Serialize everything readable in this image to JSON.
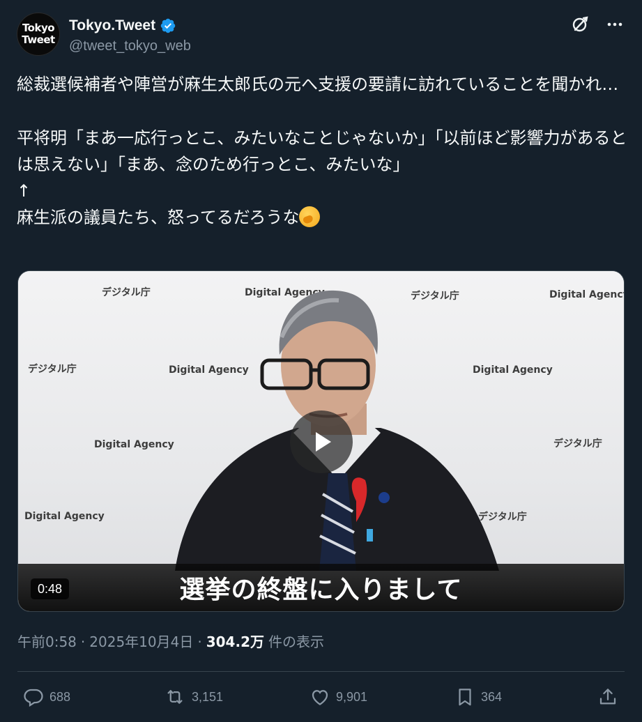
{
  "author": {
    "display_name": "Tokyo.Tweet",
    "handle": "@tweet_tokyo_web",
    "avatar_line1": "Tokyo",
    "avatar_line2": "Tweet",
    "verified": true
  },
  "header_actions": {
    "grok_icon": "grok-icon",
    "more_icon": "more-icon"
  },
  "tweet": {
    "paragraph1": "総裁選候補者や陣営が麻生太郎氏の元へ支援の要請に訪れていることを聞かれ…",
    "paragraph2": "平将明「まあ一応行っとこ、みたいなことじゃないか」「以前ほど影響力があるとは思えない」「まあ、念のため行っとこ、みたいな」",
    "arrow": "↑",
    "paragraph3": "麻生派の議員たち、怒ってるだろうな",
    "emoji_name": "face-with-hand-over-mouth"
  },
  "video": {
    "subtitle": "選挙の終盤に入りまして",
    "duration": "0:48",
    "watermarks": [
      "デジタル庁",
      "Digital Agency"
    ]
  },
  "meta": {
    "time": "午前0:58",
    "separator": "·",
    "date": "2025年10月4日",
    "views": "304.2万",
    "views_label": "件の表示"
  },
  "actions": {
    "replies": "688",
    "reposts": "3,151",
    "likes": "9,901",
    "bookmarks": "364"
  },
  "colors": {
    "background": "#15202b",
    "text_primary": "#f7f9f9",
    "text_secondary": "#8b98a5",
    "verified_blue": "#1d9bf0",
    "divider": "#38444d"
  }
}
